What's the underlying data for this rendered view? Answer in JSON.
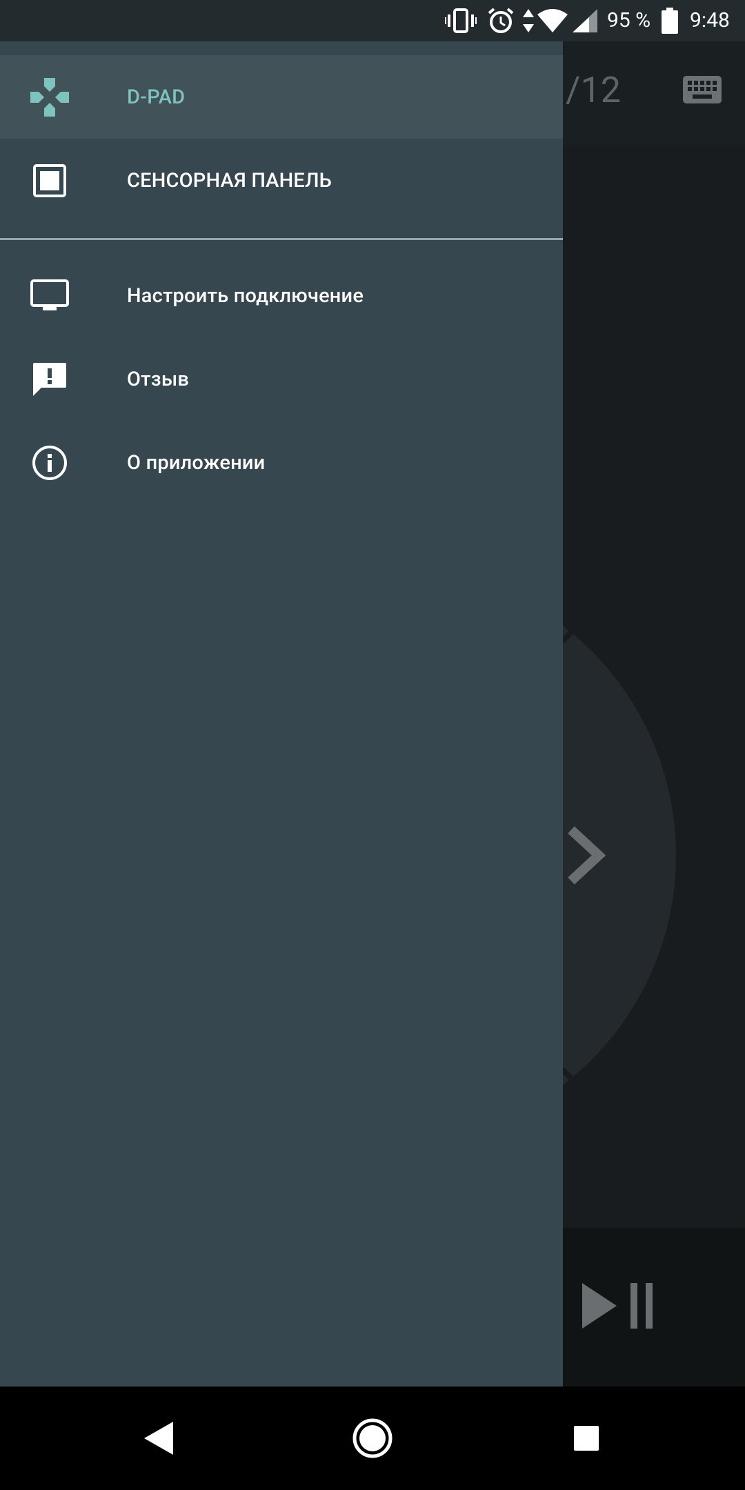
{
  "status_bar": {
    "battery_percent": "95 %",
    "time": "9:48",
    "icons": [
      "vibrate-icon",
      "alarm-icon",
      "data-arrows-icon",
      "wifi-icon",
      "signal-icon",
      "battery-icon"
    ]
  },
  "background_app": {
    "page_indicator": "/12",
    "keyboard_icon": "keyboard-icon",
    "dpad_icon": "chevron-right-icon",
    "playpause_icon": "play-pause-icon"
  },
  "drawer": {
    "primary_items": [
      {
        "label": "D-PAD",
        "icon": "dpad-icon",
        "selected": true
      },
      {
        "label": "СЕНСОРНАЯ ПАНЕЛЬ",
        "icon": "touchpad-icon",
        "selected": false
      }
    ],
    "secondary_items": [
      {
        "label": "Настроить подключение",
        "icon": "tv-icon"
      },
      {
        "label": "Отзыв",
        "icon": "feedback-icon"
      },
      {
        "label": "О приложении",
        "icon": "info-icon"
      }
    ]
  },
  "nav_bar": {
    "icons": [
      "back-icon",
      "home-icon",
      "recents-icon"
    ]
  },
  "colors": {
    "drawer_bg": "#36474f",
    "selected_bg": "#415259",
    "accent": "#7cc4bd",
    "status_bar": "#242b2f"
  }
}
